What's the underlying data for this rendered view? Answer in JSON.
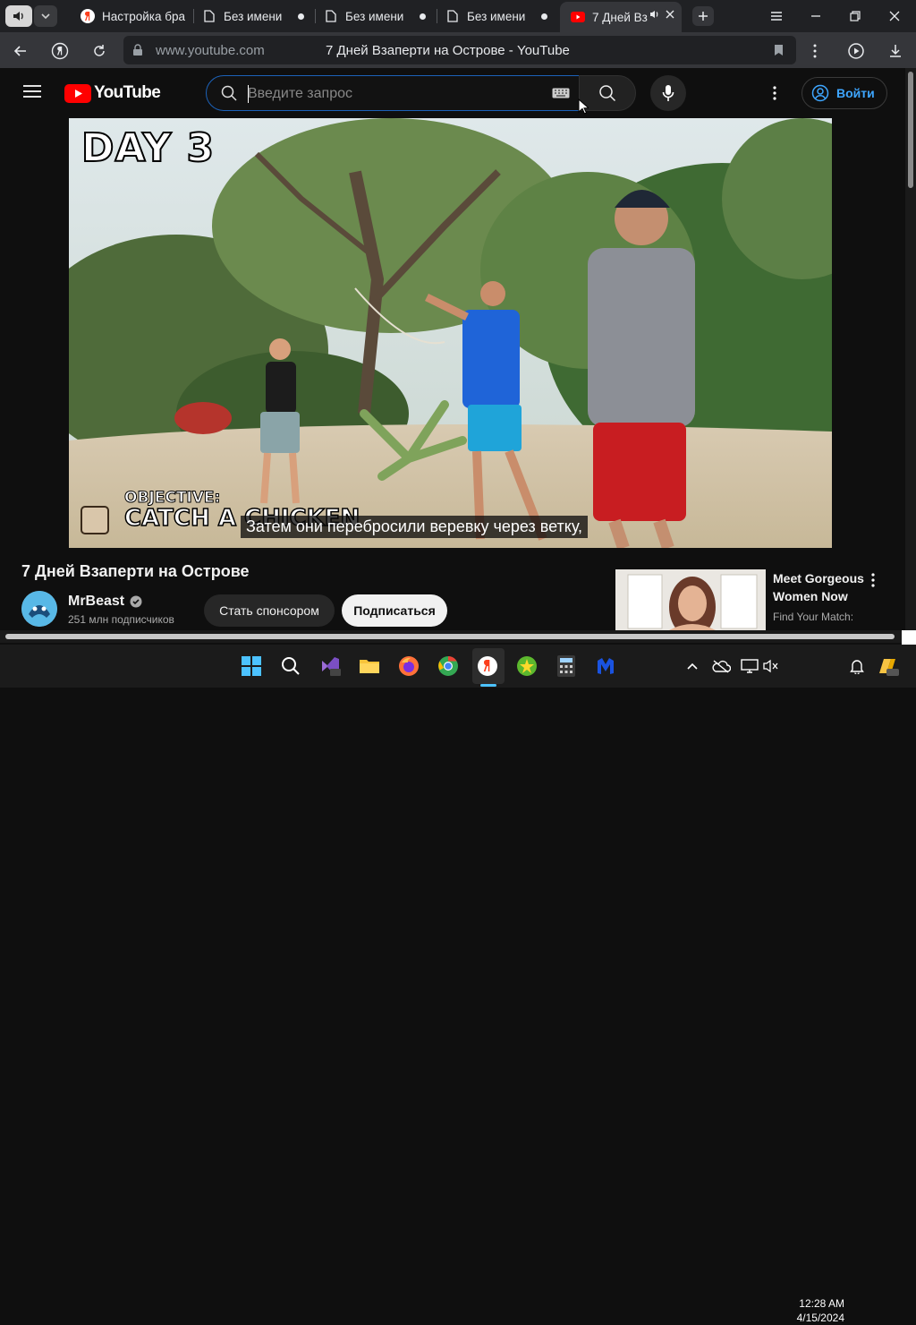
{
  "browser": {
    "tabs": [
      {
        "label": "Настройка бра",
        "active": false
      },
      {
        "label": "Без имени",
        "active": false
      },
      {
        "label": "Без имени",
        "active": false
      },
      {
        "label": "Без имени",
        "active": false
      },
      {
        "label": "7 Дней Вз",
        "active": true
      }
    ],
    "address_host": "www.youtube.com",
    "address_title": "7 Дней Взаперти на Острове - YouTube"
  },
  "youtube": {
    "logo_text": "YouTube",
    "search_placeholder": "Введите запрос",
    "signin_label": "Войти"
  },
  "video": {
    "overlay_day": "DAY 3",
    "overlay_objective_label": "OBJECTIVE:",
    "overlay_objective_text": "CATCH A CHICKEN",
    "subtitle": "Затем они перебросили веревку через ветку,",
    "title": "7 Дней Взаперти на Острове"
  },
  "channel": {
    "name": "MrBeast",
    "subscribers": "251 млн подписчиков",
    "sponsor_label": "Стать спонсором",
    "subscribe_label": "Подписаться"
  },
  "ad": {
    "title": "Meet Gorgeous Women Now",
    "subtitle": "Find Your Match:"
  },
  "taskbar": {
    "time": "12:28 AM",
    "date": "4/15/2024"
  },
  "colors": {
    "yt_red": "#ff0000",
    "accent_blue": "#3ea6ff",
    "search_focus": "#1c62b9"
  }
}
